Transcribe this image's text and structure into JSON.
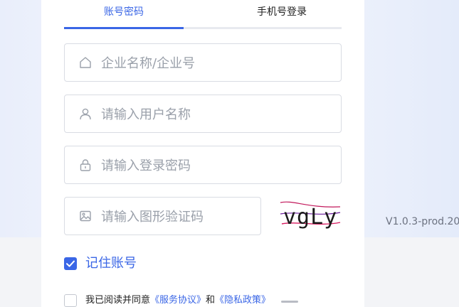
{
  "tabs": {
    "account_label": "账号密码",
    "phone_label": "手机号登录"
  },
  "fields": {
    "company_placeholder": "企业名称/企业号",
    "username_placeholder": "请输入用户名称",
    "password_placeholder": "请输入登录密码",
    "captcha_placeholder": "请输入图形验证码"
  },
  "captcha": {
    "text": "vgLy"
  },
  "version": "V1.0.3-prod.20",
  "remember": {
    "label": "记住账号",
    "checked": true
  },
  "agreement": {
    "prefix": "我已阅读并同意",
    "service_link": "《服务协议》",
    "and": "和",
    "privacy_link": "《隐私政策》"
  },
  "colors": {
    "accent": "#3a66e6",
    "border": "#d9dce3",
    "placeholder": "#9aa0aa"
  },
  "icons": {
    "company": "home-icon",
    "user": "user-icon",
    "password": "lock-icon",
    "captcha": "image-icon",
    "remember": "checkbox-checked-icon"
  }
}
